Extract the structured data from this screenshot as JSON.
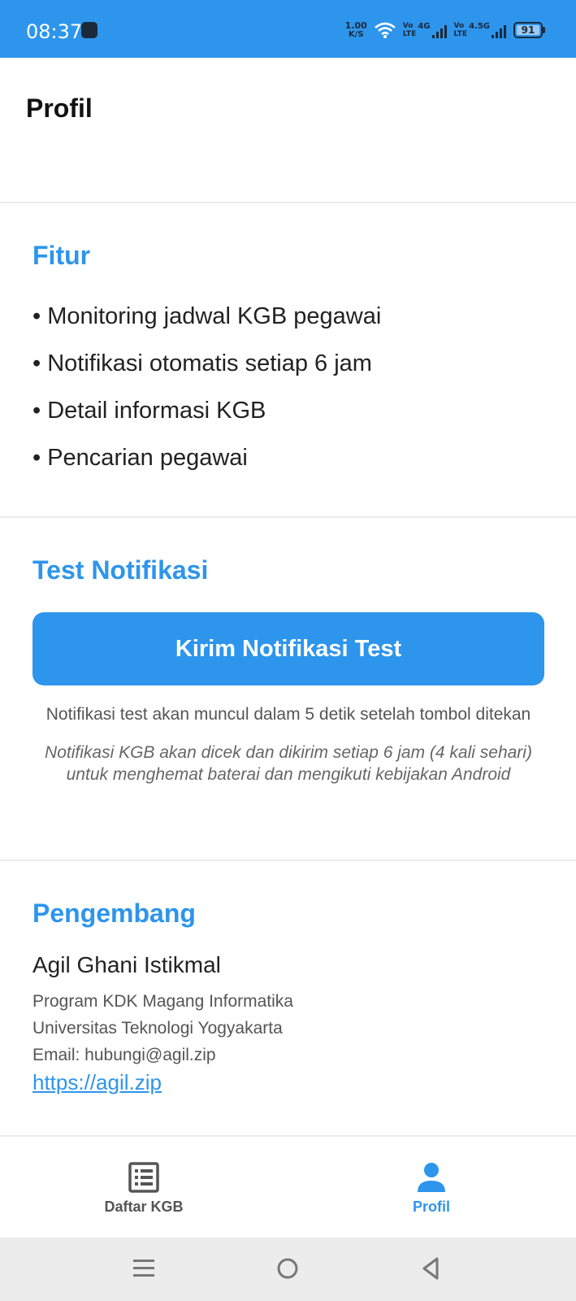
{
  "status_bar": {
    "time": "08:37",
    "speed_value": "1.00",
    "speed_unit": "K/S",
    "sim1_top": "Vo",
    "sim1_bottom": "LTE",
    "sim1_gen": "4G",
    "sim2_top": "Vo",
    "sim2_bottom": "LTE",
    "sim2_gen": "4.5G",
    "battery": "91"
  },
  "app_bar": {
    "title": "Profil"
  },
  "features": {
    "title": "Fitur",
    "items": [
      "• Monitoring jadwal KGB pegawai",
      "• Notifikasi otomatis setiap 6 jam",
      "• Detail informasi KGB",
      "• Pencarian pegawai"
    ]
  },
  "test": {
    "title": "Test Notifikasi",
    "button_label": "Kirim Notifikasi Test",
    "note": "Notifikasi test akan muncul dalam 5 detik setelah tombol ditekan",
    "info": "Notifikasi KGB akan dicek dan dikirim setiap 6 jam (4 kali sehari) untuk menghemat baterai dan mengikuti kebijakan Android"
  },
  "developer": {
    "title": "Pengembang",
    "name": "Agil Ghani Istikmal",
    "program": "Program KDK Magang Informatika",
    "university": "Universitas Teknologi Yogyakarta",
    "email": "Email: hubungi@agil.zip",
    "link": "https://agil.zip"
  },
  "bottom_nav": {
    "items": [
      {
        "label": "Daftar KGB",
        "icon": "list-icon",
        "active": false
      },
      {
        "label": "Profil",
        "icon": "person-icon",
        "active": true
      }
    ]
  },
  "colors": {
    "primary": "#2d95ec",
    "divider": "#ececec",
    "system_nav": "#ececec"
  }
}
